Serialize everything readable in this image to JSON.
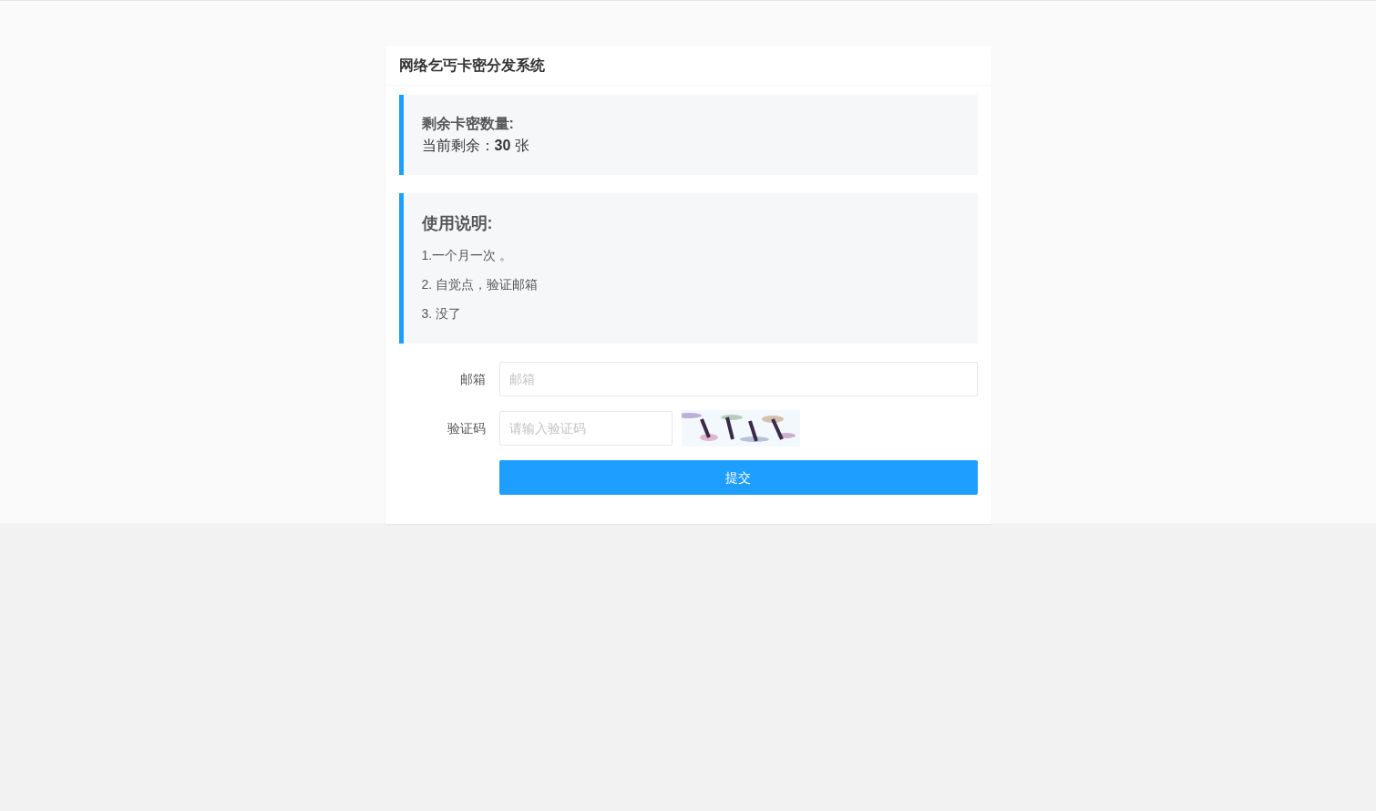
{
  "card": {
    "title": "网络乞丐卡密分发系统"
  },
  "stock_note": {
    "heading": "剩余卡密数量:",
    "text": "当前剩余：**30** 张"
  },
  "instructions": {
    "heading": "使用说明:",
    "items": [
      "1.一个月一次 。",
      "2. 自觉点，验证邮箱",
      "3. 没了"
    ]
  },
  "form": {
    "fields": [
      {
        "kind": "text",
        "label": "邮箱",
        "placeholder": "邮箱"
      },
      {
        "kind": "captcha",
        "label": "验证码",
        "placeholder": "请输入验证码"
      }
    ],
    "submit": "提交"
  }
}
